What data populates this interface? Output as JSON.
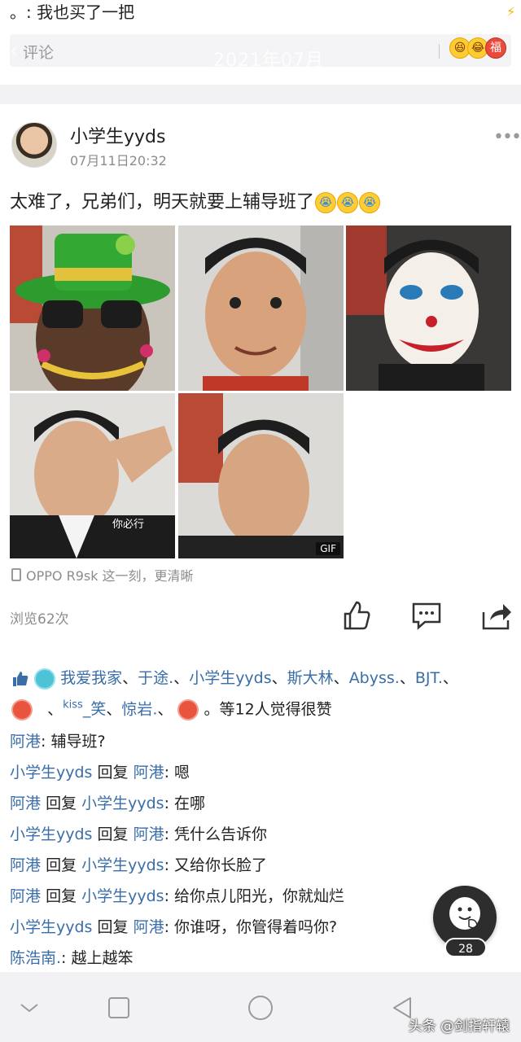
{
  "top": {
    "comment_tail": "。: 我也买了一把",
    "comment_placeholder": "评论",
    "month_ghost": "2021年07月",
    "emoji_icons": [
      "laughing-emoji",
      "grin-emoji",
      "red-packet-emoji"
    ]
  },
  "post": {
    "author": "小学生yyds",
    "time": "07月11日20:32",
    "text": "太难了，兄弟们，明天就要上辅导班了",
    "text_emojis": [
      "crying-emoji",
      "crying-emoji",
      "crying-emoji"
    ],
    "photos": [
      {
        "name": "photo-hat-sunglasses"
      },
      {
        "name": "photo-boy-smile"
      },
      {
        "name": "photo-joker-face"
      },
      {
        "name": "photo-boy-salute"
      },
      {
        "name": "photo-boy-gif"
      }
    ],
    "gif_badge": "GIF",
    "salute_caption": "你必行",
    "device": "OPPO R9sk 这一刻，更清晰",
    "views": "浏览62次"
  },
  "likes": {
    "names_line1": [
      "我爱我家",
      "于途.",
      "小学生yyds",
      "斯大林",
      "Abyss.",
      "BJT."
    ],
    "kiss_name_sup": "kiss",
    "kiss_name_rest": "_笑",
    "names_line2_rest": [
      "惊岩."
    ],
    "suffix": "。等12人觉得很赞"
  },
  "comments": [
    {
      "user": "阿港",
      "reply_to": "",
      "text": "辅导班?"
    },
    {
      "user": "小学生yyds",
      "reply_to": "阿港",
      "text": "嗯"
    },
    {
      "user": "阿港",
      "reply_to": "小学生yyds",
      "text": "在哪"
    },
    {
      "user": "小学生yyds",
      "reply_to": "阿港",
      "text": "凭什么告诉你"
    },
    {
      "user": "阿港",
      "reply_to": "小学生yyds",
      "text": "又给你长脸了"
    },
    {
      "user": "阿港",
      "reply_to": "小学生yyds",
      "text": "给你点儿阳光，你就灿烂"
    },
    {
      "user": "小学生yyds",
      "reply_to": "阿港",
      "text": "你谁呀，你管得着吗你?"
    },
    {
      "user": "陈浩南.",
      "reply_to": "",
      "text": "越上越笨"
    }
  ],
  "reply_word": "回复",
  "fab_count": "28",
  "watermark": "头条 @剑指轩辕",
  "colors": {
    "link": "#3a6ea8",
    "muted": "#8c8c8c",
    "fab": "#2d2d2d"
  }
}
